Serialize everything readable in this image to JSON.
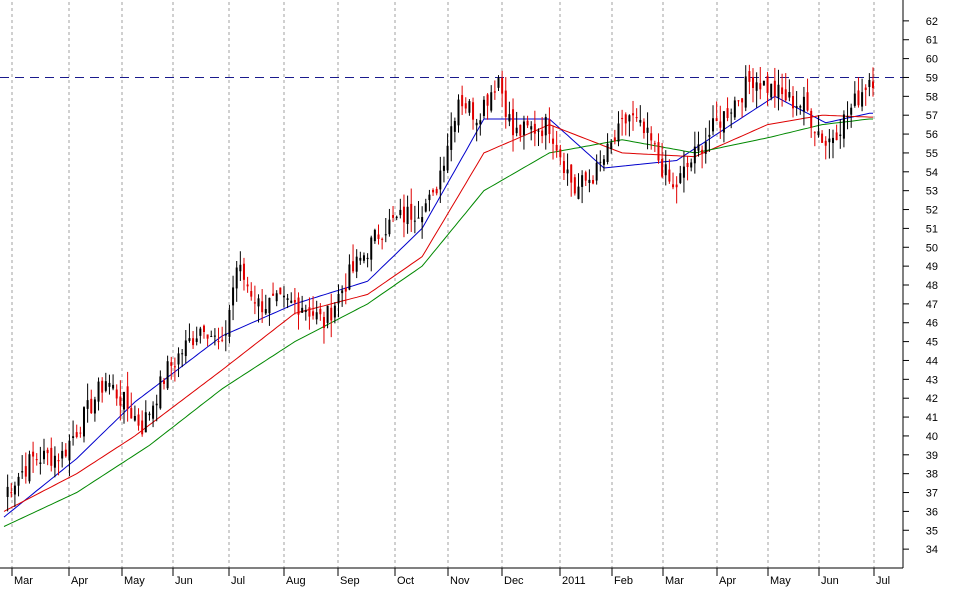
{
  "colors": {
    "up_candle": "#000000",
    "down_candle": "#e00000",
    "ma_short": "#0000cc",
    "ma_mid": "#dd0000",
    "ma_long": "#008800",
    "resistance": "#1a1a8c",
    "grid": "#a0a0a0"
  },
  "chart_data": {
    "type": "line",
    "subtype": "candlestick with moving averages",
    "title": "",
    "xlabel": "",
    "ylabel": "",
    "ylim": [
      33,
      63
    ],
    "y_ticks": [
      34,
      35,
      36,
      37,
      38,
      39,
      40,
      41,
      42,
      43,
      44,
      45,
      46,
      47,
      48,
      49,
      50,
      51,
      52,
      53,
      54,
      55,
      56,
      57,
      58,
      59,
      60,
      61,
      62
    ],
    "x_month_labels": [
      "Mar",
      "Apr",
      "May",
      "Jun",
      "Jul",
      "Aug",
      "Sep",
      "Oct",
      "Nov",
      "Dec",
      "2011",
      "Feb",
      "Mar",
      "Apr",
      "May",
      "Jun",
      "Jul"
    ],
    "grid": "vertical dashed at month starts",
    "resistance_level": 59,
    "price_keypoints": [
      {
        "i": 0,
        "close": 37.0
      },
      {
        "i": 8,
        "close": 38.8
      },
      {
        "i": 16,
        "close": 39.0
      },
      {
        "i": 22,
        "close": 41.0
      },
      {
        "i": 28,
        "close": 43.0
      },
      {
        "i": 34,
        "close": 41.5
      },
      {
        "i": 38,
        "close": 40.5
      },
      {
        "i": 45,
        "close": 43.5
      },
      {
        "i": 55,
        "close": 46.0
      },
      {
        "i": 60,
        "close": 44.5
      },
      {
        "i": 64,
        "close": 49.0
      },
      {
        "i": 70,
        "close": 47.0
      },
      {
        "i": 82,
        "close": 47.0
      },
      {
        "i": 88,
        "close": 46.0
      },
      {
        "i": 95,
        "close": 48.5
      },
      {
        "i": 104,
        "close": 51.0
      },
      {
        "i": 118,
        "close": 52.5
      },
      {
        "i": 125,
        "close": 58.0
      },
      {
        "i": 130,
        "close": 57.0
      },
      {
        "i": 136,
        "close": 59.0
      },
      {
        "i": 140,
        "close": 56.0
      },
      {
        "i": 150,
        "close": 56.5
      },
      {
        "i": 157,
        "close": 53.0
      },
      {
        "i": 163,
        "close": 54.0
      },
      {
        "i": 172,
        "close": 57.0
      },
      {
        "i": 178,
        "close": 55.5
      },
      {
        "i": 184,
        "close": 53.0
      },
      {
        "i": 192,
        "close": 55.5
      },
      {
        "i": 200,
        "close": 57.5
      },
      {
        "i": 206,
        "close": 59.0
      },
      {
        "i": 214,
        "close": 58.0
      },
      {
        "i": 220,
        "close": 57.5
      },
      {
        "i": 226,
        "close": 55.5
      },
      {
        "i": 232,
        "close": 57.0
      },
      {
        "i": 238,
        "close": 59.0
      }
    ],
    "series": [
      {
        "key": "ma_short",
        "values_keypoints": [
          [
            0,
            35.7
          ],
          [
            20,
            38.8
          ],
          [
            36,
            41.8
          ],
          [
            60,
            45.3
          ],
          [
            80,
            47.0
          ],
          [
            100,
            48.2
          ],
          [
            115,
            51.0
          ],
          [
            132,
            56.8
          ],
          [
            150,
            56.8
          ],
          [
            165,
            54.2
          ],
          [
            185,
            54.6
          ],
          [
            200,
            56.5
          ],
          [
            212,
            58.0
          ],
          [
            226,
            56.6
          ],
          [
            238,
            57.1
          ]
        ]
      },
      {
        "key": "ma_mid",
        "values_keypoints": [
          [
            0,
            36.0
          ],
          [
            20,
            38.0
          ],
          [
            36,
            40.0
          ],
          [
            60,
            43.5
          ],
          [
            80,
            46.5
          ],
          [
            100,
            47.5
          ],
          [
            115,
            49.5
          ],
          [
            132,
            55.0
          ],
          [
            150,
            56.5
          ],
          [
            170,
            55.0
          ],
          [
            190,
            54.8
          ],
          [
            210,
            56.5
          ],
          [
            225,
            57.0
          ],
          [
            238,
            56.9
          ]
        ]
      },
      {
        "key": "ma_long",
        "values_keypoints": [
          [
            0,
            35.2
          ],
          [
            20,
            37.0
          ],
          [
            40,
            39.5
          ],
          [
            60,
            42.5
          ],
          [
            80,
            45.0
          ],
          [
            100,
            47.0
          ],
          [
            115,
            49.0
          ],
          [
            132,
            53.0
          ],
          [
            150,
            55.0
          ],
          [
            170,
            55.7
          ],
          [
            190,
            55.0
          ],
          [
            210,
            55.8
          ],
          [
            225,
            56.5
          ],
          [
            238,
            56.8
          ]
        ]
      }
    ]
  }
}
